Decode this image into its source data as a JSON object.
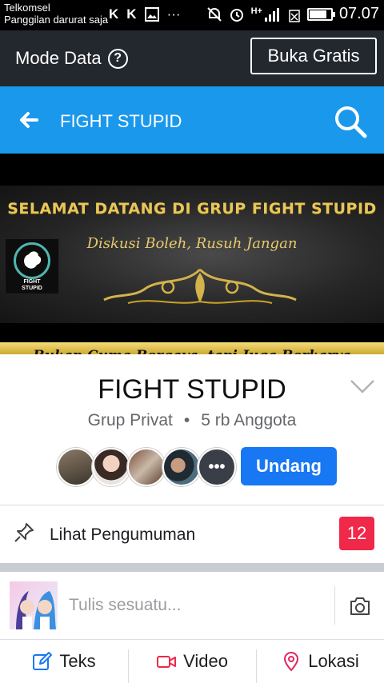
{
  "status_bar": {
    "carrier": "Telkomsel",
    "emergency_note": "Panggilan darurat saja",
    "notification_icons": [
      "K",
      "K"
    ],
    "signal_type": "H+",
    "time": "07.07"
  },
  "data_mode": {
    "label": "Mode Data",
    "help_icon": "?",
    "free_button": "Buka Gratis"
  },
  "header": {
    "title": "FIGHT STUPID"
  },
  "cover": {
    "headline": "SELAMAT DATANG DI GRUP FIGHT STUPID",
    "subtitle": "Diskusi Boleh, Rusuh Jangan",
    "ribbon": "Bukan Cuma Bergaya, tapi Juga Berkarya",
    "logo_text_line1": "FIGHT",
    "logo_text_line2": "STUPID"
  },
  "group": {
    "name": "FIGHT STUPID",
    "privacy": "Grup Privat",
    "separator": "•",
    "members": "5 rb Anggota",
    "more_members": "•••",
    "invite_button": "Undang"
  },
  "announcements": {
    "label": "Lihat Pengumuman",
    "count": "12"
  },
  "composer": {
    "placeholder": "Tulis sesuatu..."
  },
  "actions": {
    "text": "Teks",
    "video": "Video",
    "location": "Lokasi"
  },
  "colors": {
    "header_blue": "#1a98ec",
    "data_bar": "#23272e",
    "invite_blue": "#1877f2",
    "badge_red": "#f02849"
  }
}
